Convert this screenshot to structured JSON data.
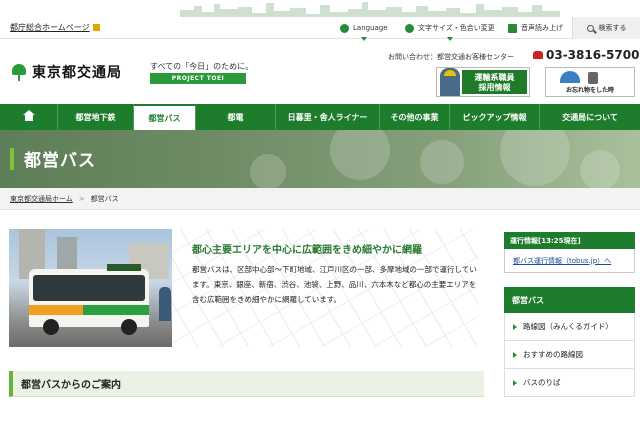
{
  "topbar": {
    "home_link": "都庁総合ホームページ",
    "language": "Language",
    "text_size": "文字サイズ・色合い変更",
    "speech": "音声読み上げ",
    "search": "検索する"
  },
  "header": {
    "logo_text": "東京都交通局",
    "tagline": "すべての「今日」のために。",
    "tagline_badge": "PROJECT TOEI",
    "contact_label": "お問い合わせ：都営交通お客様センター",
    "phone": "03-3816-5700",
    "banner_recruit": "運輸系職員\n採用情報",
    "banner_lost": "お忘れ物をした時"
  },
  "nav": {
    "items": [
      {
        "label": "都営地下鉄"
      },
      {
        "label": "都営バス"
      },
      {
        "label": "都電"
      },
      {
        "label": "日暮里・舎人ライナー"
      },
      {
        "label": "その他の事業"
      },
      {
        "label": "ピックアップ情報"
      },
      {
        "label": "交通局について"
      }
    ]
  },
  "hero": {
    "title": "都営バス"
  },
  "breadcrumb": {
    "home": "東京都交通局ホーム",
    "current": "都営バス"
  },
  "main": {
    "heading": "都心主要エリアを中心に広範囲をきめ細やかに網羅",
    "paragraph": "都営バスは、区部中心部〜下町地域、江戸川区の一部、多摩地域の一部で運行しています。東京、銀座、新宿、渋谷、池袋、上野、品川、六本木など都心の主要エリアを含む広範囲をきめ細やかに網羅しています。",
    "section_title": "都営バスからのご案内"
  },
  "sidebar": {
    "operation_header": "運行情報[13:25現在]",
    "operation_link": "都バス運行情報（tobus.jp）へ",
    "bus_header": "都営バス",
    "bus_items": [
      {
        "label": "路線図（みんくるガイド）"
      },
      {
        "label": "おすすめの路線図"
      },
      {
        "label": "バスのりば"
      }
    ]
  },
  "colors": {
    "brand_green": "#1e7d2c",
    "accent_lime": "#7ec23a",
    "phone_red": "#d42020"
  }
}
